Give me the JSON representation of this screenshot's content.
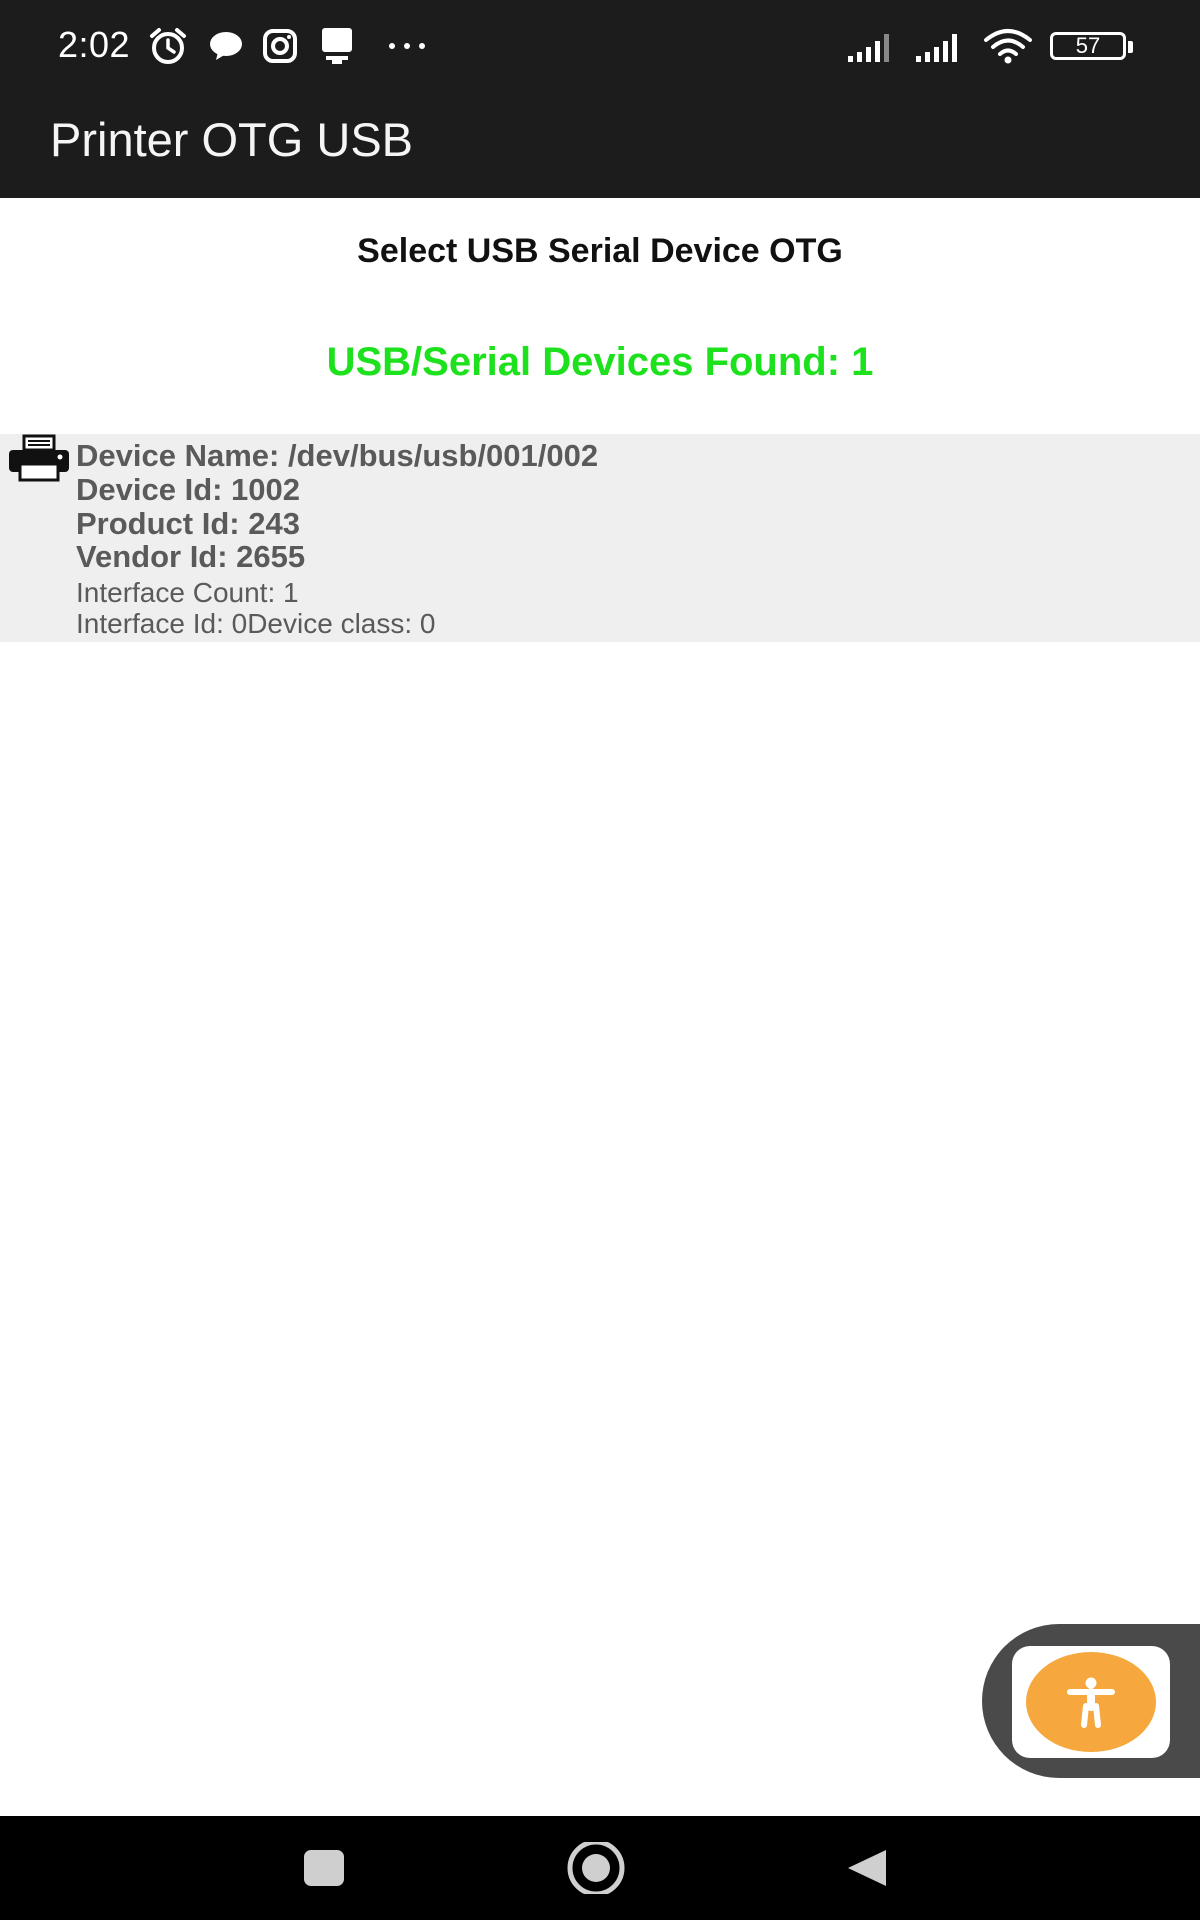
{
  "status_bar": {
    "time": "2:02",
    "battery_level": "57",
    "icons": [
      "alarm-icon",
      "chat-bubble-icon",
      "instagram-icon",
      "download-icon",
      "more-dots-icon",
      "signal-icon",
      "signal-icon",
      "wifi-icon",
      "battery-icon"
    ]
  },
  "app_bar": {
    "title": "Printer OTG USB"
  },
  "content": {
    "select_title": "Select USB Serial Device OTG",
    "found_label": "USB/Serial Devices Found: 1",
    "found_color": "#1ce11c",
    "devices": [
      {
        "icon": "printer-icon",
        "name": "Device Name: /dev/bus/usb/001/002",
        "device_id": "Device Id: 1002",
        "product_id": "Product Id: 243",
        "vendor_id": "Vendor Id: 2655",
        "interface_count": "Interface Count: 1",
        "interface_info": "Interface Id: 0Device class: 0"
      }
    ]
  },
  "floating_button": {
    "icon": "accessibility-icon",
    "color": "#f6a73d"
  },
  "nav_bar": {
    "buttons": [
      "recents-square-icon",
      "home-circle-icon",
      "back-triangle-icon"
    ]
  }
}
